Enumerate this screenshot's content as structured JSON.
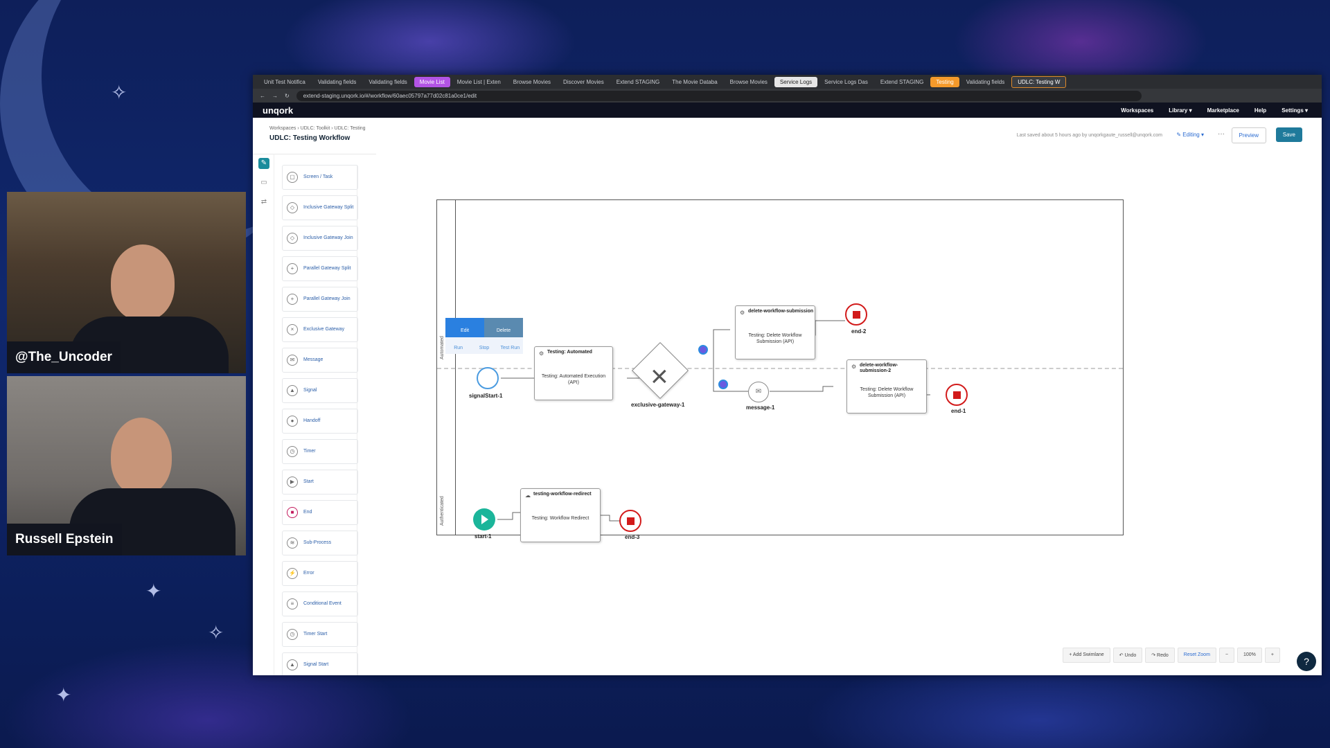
{
  "colors": {
    "accent": "#1f7a9b",
    "end_event": "#d21a1a",
    "start_event": "#1bb59a",
    "link": "#2a6bd1"
  },
  "streamers": [
    {
      "name": "@The_Uncoder"
    },
    {
      "name": "Russell Epstein"
    }
  ],
  "browser": {
    "tabs": [
      {
        "label": "Unit Test Notifica"
      },
      {
        "label": "Validating fields"
      },
      {
        "label": "Validating fields"
      },
      {
        "label": "Movie List"
      },
      {
        "label": "Movie List | Exten"
      },
      {
        "label": "Browse Movies"
      },
      {
        "label": "Discover Movies"
      },
      {
        "label": "Extend STAGING"
      },
      {
        "label": "The Movie Databa"
      },
      {
        "label": "Browse Movies"
      },
      {
        "label": "Service Logs"
      },
      {
        "label": "Service Logs Das"
      },
      {
        "label": "Extend STAGING"
      },
      {
        "label": "Testing"
      },
      {
        "label": "Validating fields"
      },
      {
        "label": "UDLC: Testing W"
      }
    ],
    "url": "extend-staging.unqork.io/#/workflow/60aec05797a77d02c81a0ce1/edit"
  },
  "app": {
    "logo": "unqork",
    "nav": [
      "Workspaces",
      "Library ▾",
      "Marketplace",
      "Help",
      "Settings ▾"
    ]
  },
  "header": {
    "breadcrumb": [
      "Workspaces",
      "UDLC: Toolkit",
      "UDLC: Testing"
    ],
    "title": "UDLC: Testing Workflow",
    "saved": "Last saved about 5 hours ago by unqorkgaute_russell@unqork.com",
    "editing": "Editing",
    "preview": "Preview",
    "save": "Save"
  },
  "palette": [
    {
      "label": "Screen / Task",
      "icon": "screen-icon"
    },
    {
      "label": "Inclusive Gateway Split",
      "icon": "diamond-icon"
    },
    {
      "label": "Inclusive Gateway Join",
      "icon": "diamond-icon"
    },
    {
      "label": "Parallel Gateway Split",
      "icon": "plus-diamond-icon"
    },
    {
      "label": "Parallel Gateway Join",
      "icon": "plus-diamond-icon"
    },
    {
      "label": "Exclusive Gateway",
      "icon": "x-diamond-icon"
    },
    {
      "label": "Message",
      "icon": "envelope-icon"
    },
    {
      "label": "Signal",
      "icon": "triangle-icon"
    },
    {
      "label": "Handoff",
      "icon": "handoff-icon"
    },
    {
      "label": "Timer",
      "icon": "clock-icon"
    },
    {
      "label": "Start",
      "icon": "play-icon"
    },
    {
      "label": "End",
      "icon": "stop-icon"
    },
    {
      "label": "Sub-Process",
      "icon": "layers-icon"
    },
    {
      "label": "Error",
      "icon": "error-icon"
    },
    {
      "label": "Conditional Event",
      "icon": "conditional-icon"
    },
    {
      "label": "Timer Start",
      "icon": "clock-icon"
    },
    {
      "label": "Signal Start",
      "icon": "triangle-icon"
    }
  ],
  "diagram": {
    "lanes": [
      "Automated",
      "Authenticated"
    ],
    "element_toolbar": {
      "edit": "Edit",
      "delete": "Delete",
      "run": "Run",
      "stop": "Stop",
      "test_run": "Test Run"
    },
    "tasks": {
      "testing_automated": {
        "title": "Testing: Automated",
        "body": "Testing: Automated Execution (API)"
      },
      "delete_submission": {
        "title": "delete-workflow-submission",
        "body": "Testing: Delete Workflow Submission (API)"
      },
      "delete_submission_2": {
        "title": "delete-workflow-submission-2",
        "body": "Testing: Delete Workflow Submission (API)"
      },
      "redirect": {
        "title": "testing-workflow-redirect",
        "body": "Testing: Workflow Redirect"
      }
    },
    "events": {
      "signal_start": "signalStart-1",
      "gateway": "exclusive-gateway-1",
      "message": "message-1",
      "end1": "end-1",
      "end2": "end-2",
      "end3": "end-3",
      "start1": "start-1"
    }
  },
  "bottom_toolbar": {
    "add_swimlane": "+ Add Swimlane",
    "undo": "Undo",
    "redo": "Redo",
    "reset_zoom": "Reset Zoom",
    "zoom_out": "−",
    "zoom": "100%",
    "zoom_in": "+"
  },
  "help": "?"
}
